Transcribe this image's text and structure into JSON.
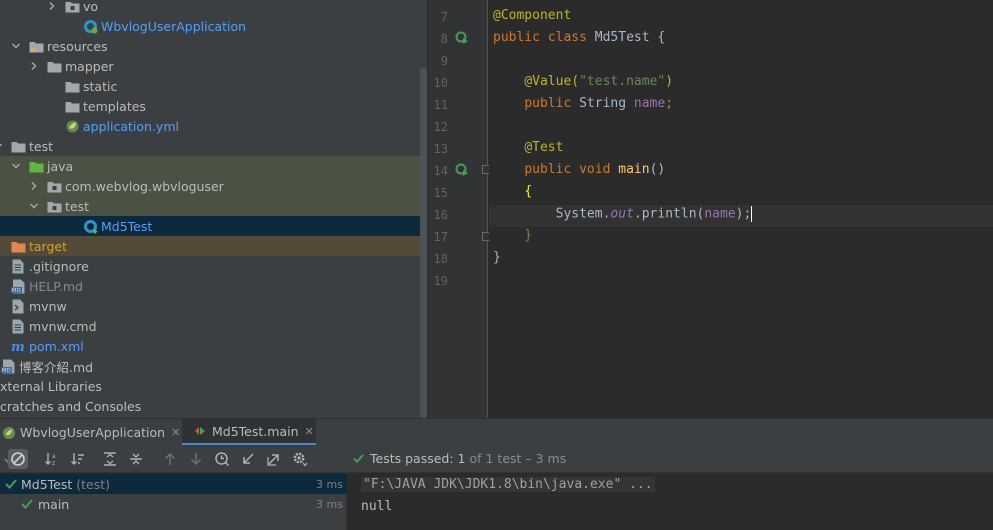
{
  "project_tree": {
    "items": [
      {
        "label": "vo",
        "arrow": "right",
        "icon": "package-folder-icon",
        "color": "norm"
      },
      {
        "label": "WbvlogUserApplication",
        "arrow": "",
        "icon": "spring-boot-class-icon",
        "color": "blue"
      },
      {
        "label": "resources",
        "arrow": "down",
        "icon": "resources-folder-icon",
        "color": "norm"
      },
      {
        "label": "mapper",
        "arrow": "right",
        "icon": "folder-icon",
        "color": "norm"
      },
      {
        "label": "static",
        "arrow": "",
        "icon": "folder-icon",
        "color": "norm"
      },
      {
        "label": "templates",
        "arrow": "",
        "icon": "folder-icon",
        "color": "norm"
      },
      {
        "label": "application.yml",
        "arrow": "",
        "icon": "spring-config-icon",
        "color": "blue"
      },
      {
        "label": "test",
        "arrow": "down",
        "icon": "folder-icon",
        "color": "norm"
      },
      {
        "label": "java",
        "arrow": "down",
        "icon": "test-source-folder-icon",
        "color": "norm"
      },
      {
        "label": "com.webvlog.wbvloguser",
        "arrow": "right",
        "icon": "package-folder-icon",
        "color": "norm"
      },
      {
        "label": "test",
        "arrow": "down",
        "icon": "package-folder-icon",
        "color": "norm"
      },
      {
        "label": "Md5Test",
        "arrow": "",
        "icon": "test-class-icon",
        "color": "blue"
      },
      {
        "label": "target",
        "arrow": "",
        "icon": "excluded-folder-icon",
        "color": "orange"
      },
      {
        "label": ".gitignore",
        "arrow": "",
        "icon": "text-file-icon",
        "color": "norm"
      },
      {
        "label": "HELP.md",
        "arrow": "",
        "icon": "markdown-file-icon",
        "color": "gray"
      },
      {
        "label": "mvnw",
        "arrow": "",
        "icon": "shell-file-icon",
        "color": "norm"
      },
      {
        "label": "mvnw.cmd",
        "arrow": "",
        "icon": "text-file-icon",
        "color": "norm"
      },
      {
        "label": "pom.xml",
        "arrow": "",
        "icon": "maven-icon",
        "color": "blue"
      },
      {
        "label": "博客介紹.md",
        "arrow": "",
        "icon": "markdown-file-icon",
        "color": "norm"
      },
      {
        "label": "xternal Libraries",
        "arrow": "",
        "icon": "",
        "color": "norm"
      },
      {
        "label": "cratches and Consoles",
        "arrow": "",
        "icon": "",
        "color": "norm"
      }
    ]
  },
  "editor": {
    "line_numbers": [
      "7",
      "8",
      "9",
      "10",
      "11",
      "12",
      "13",
      "14",
      "15",
      "16",
      "17",
      "18",
      "19"
    ],
    "tokens": {
      "component_ann": "@Component",
      "kw_public": "public",
      "kw_class": "class",
      "class_name": "Md5Test",
      "open_brace": "{",
      "value_ann": "@Value(",
      "value_str": "\"test.name\"",
      "value_close": ")",
      "type_string": "String",
      "field_name": "name",
      "semicolon": ";",
      "test_ann": "@Test",
      "kw_void": "void",
      "method_name": "main",
      "parens": "()",
      "method_open": "{",
      "system": "System.",
      "out": "out",
      "println": ".println(",
      "arg_name": "name",
      "call_close": ");",
      "method_close": "}",
      "class_close": "}"
    }
  },
  "run_panel": {
    "tabs": [
      "WbvlogUserApplication",
      "Md5Test.main"
    ],
    "status": {
      "passed_label": "Tests passed:",
      "count": "1",
      "detail": "of 1 test – 3 ms"
    },
    "results": [
      {
        "name": "Md5Test",
        "suffix": "(test)",
        "time": "3 ms"
      },
      {
        "name": "main",
        "suffix": "",
        "time": "3 ms"
      }
    ],
    "console": {
      "command": "\"F:\\JAVA JDK\\JDK1.8\\bin\\java.exe\" ...",
      "output": "null"
    }
  },
  "colors": {
    "pass_green": "#499c54",
    "link_blue": "#589df6",
    "excluded_orange": "#d0a32f"
  }
}
